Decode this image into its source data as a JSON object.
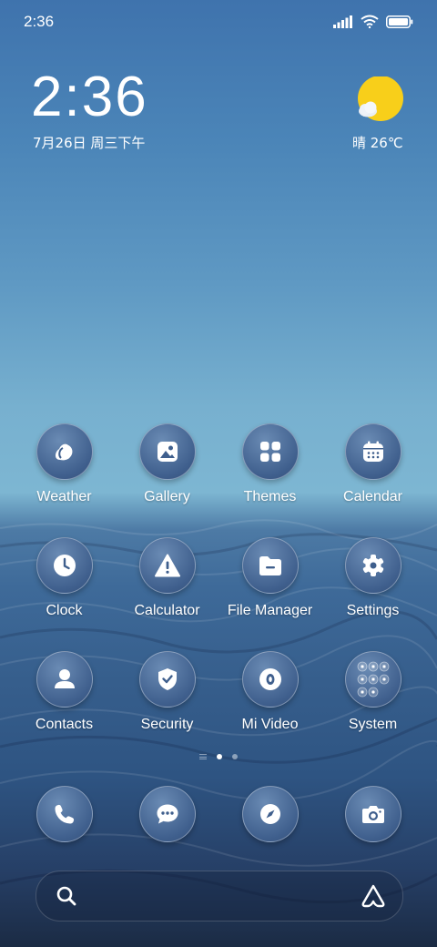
{
  "status_bar": {
    "time": "2:36",
    "icons": [
      "signal-icon",
      "wifi-icon",
      "battery-icon"
    ]
  },
  "clock_widget": {
    "time": "2:36",
    "date": "7月26日 周三下午"
  },
  "weather_widget": {
    "condition_temp": "晴 26℃",
    "icon": "sun-cloud-icon"
  },
  "apps": [
    {
      "label": "Weather",
      "icon": "weather-drop-icon"
    },
    {
      "label": "Gallery",
      "icon": "image-icon"
    },
    {
      "label": "Themes",
      "icon": "grid-icon"
    },
    {
      "label": "Calendar",
      "icon": "calendar-icon"
    },
    {
      "label": "Clock",
      "icon": "clock-icon"
    },
    {
      "label": "Calculator",
      "icon": "warning-triangle-icon"
    },
    {
      "label": "File Manager",
      "icon": "folder-icon"
    },
    {
      "label": "Settings",
      "icon": "gear-icon"
    },
    {
      "label": "Contacts",
      "icon": "person-icon"
    },
    {
      "label": "Security",
      "icon": "shield-check-icon"
    },
    {
      "label": "Mi Video",
      "icon": "video-icon"
    },
    {
      "label": "System",
      "icon": "folder-grid-icon"
    }
  ],
  "page_indicator": {
    "pages": 2,
    "current": 1
  },
  "dock": [
    {
      "icon": "phone-icon"
    },
    {
      "icon": "message-icon"
    },
    {
      "icon": "compass-icon"
    },
    {
      "icon": "camera-icon"
    }
  ],
  "search_bar": {
    "icons": [
      "search-icon",
      "assistant-icon"
    ]
  },
  "colors": {
    "sun": "#f8cf1a",
    "icon_fill": "#3f5f8d",
    "text": "#ffffff"
  }
}
